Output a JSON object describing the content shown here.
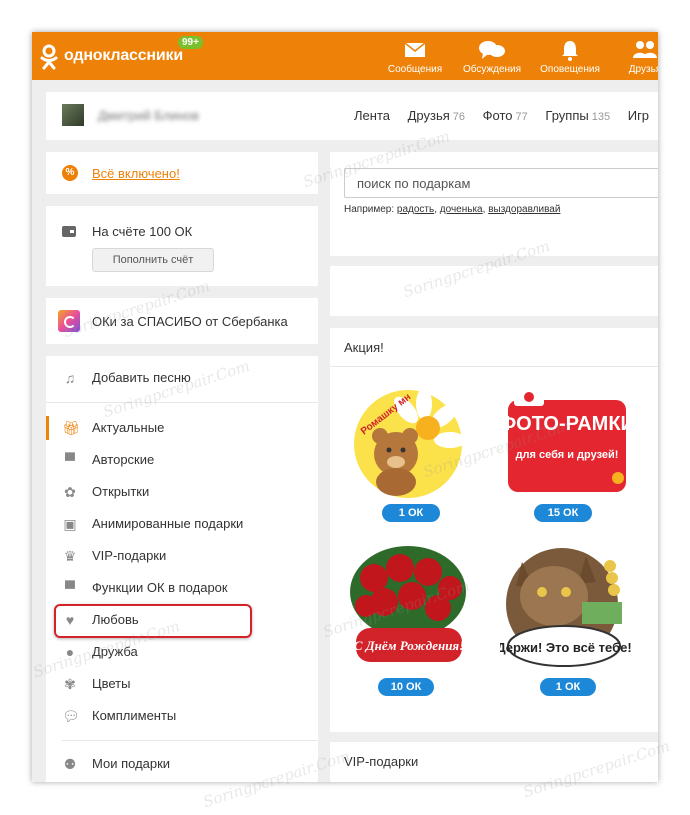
{
  "header": {
    "logo": "одноклассники",
    "badge": "99+",
    "nav": [
      {
        "label": "Сообщения",
        "icon": "envelope-icon"
      },
      {
        "label": "Обсуждения",
        "icon": "chat-bubbles-icon"
      },
      {
        "label": "Оповещения",
        "icon": "bell-icon"
      },
      {
        "label": "Друзья",
        "icon": "friends-icon"
      }
    ]
  },
  "profile": {
    "name": "Дмитрий Блинов",
    "tabs": [
      {
        "label": "Лента",
        "count": ""
      },
      {
        "label": "Друзья",
        "count": "76"
      },
      {
        "label": "Фото",
        "count": "77"
      },
      {
        "label": "Группы",
        "count": "135"
      },
      {
        "label": "Игр",
        "count": ""
      }
    ]
  },
  "sidebar": {
    "promo": "Всё включено!",
    "balance": "На счёте 100 ОК",
    "topup": "Пополнить счёт",
    "sber": "ОКи за СПАСИБО от Сбербанка",
    "menu": [
      {
        "label": "Добавить песню",
        "icon": "music-note-icon"
      },
      {
        "label": "Актуальные",
        "icon": "gift-icon"
      },
      {
        "label": "Авторские",
        "icon": "hat-icon"
      },
      {
        "label": "Открытки",
        "icon": "flower-card-icon"
      },
      {
        "label": "Анимированные подарки",
        "icon": "animated-gift-icon"
      },
      {
        "label": "VIP-подарки",
        "icon": "crown-icon"
      },
      {
        "label": "Функции ОК в подарок",
        "icon": "hat-icon"
      },
      {
        "label": "Любовь",
        "icon": "heart-icon"
      },
      {
        "label": "Дружба",
        "icon": "people-icon"
      },
      {
        "label": "Цветы",
        "icon": "flower-icon"
      },
      {
        "label": "Комплименты",
        "icon": "speech-bubble-icon"
      },
      {
        "label": "Мои подарки",
        "icon": "my-gifts-icon"
      }
    ]
  },
  "search": {
    "placeholder": "поиск по подаркам",
    "examples_prefix": "Например:",
    "examples": [
      "радость",
      "доченька",
      "выздоравливай"
    ]
  },
  "action": {
    "title": "Акция!",
    "gifts": [
      {
        "name": "bear-daisy-sticker",
        "text": "Ромашку мн",
        "price": "1 ОК"
      },
      {
        "name": "photo-frames-sticker",
        "title": "ФОТО-РАМКИ",
        "subtitle": "для себя и друзей!",
        "price": "15 ОК"
      },
      {
        "name": "roses-birthday-sticker",
        "text": "С Днём Рождения!",
        "price": "10 ОК"
      },
      {
        "name": "cat-money-sticker",
        "text": "Держи! Это всё тебе!",
        "price": "1 ОК"
      }
    ]
  },
  "vip": {
    "title": "VIP-подарки"
  },
  "watermark": "Soringpcrepair.Com",
  "colors": {
    "brand": "#ee8208",
    "price": "#1e88d8",
    "highlight": "#d2232a"
  }
}
